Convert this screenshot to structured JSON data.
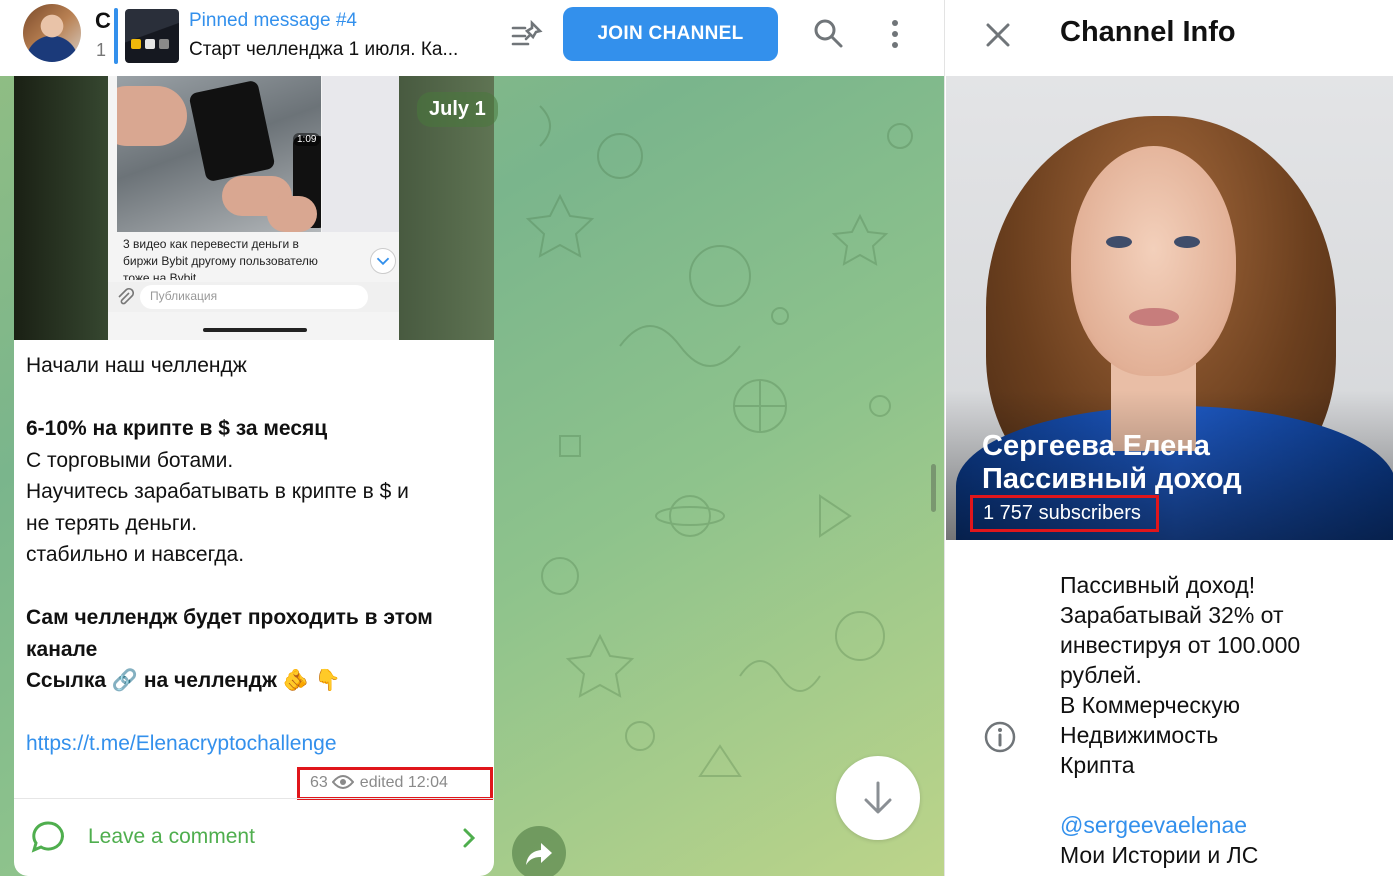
{
  "header": {
    "channel_initial": "С",
    "channel_sub": "1",
    "pinned_title": "Pinned message #4",
    "pinned_text": "Старт челленджа 1 июля. Ка...",
    "join_label": "JOIN CHANNEL"
  },
  "message": {
    "date": "July 1",
    "media": {
      "video_time": "1:09",
      "caption": "3 видео как перевести деньги в биржи Bybit другому пользователю тоже на Bybit",
      "input_placeholder": "Публикация"
    },
    "lines": [
      {
        "text": "Начали наш челлендж",
        "bold": false
      },
      {
        "text": "",
        "bold": false
      },
      {
        "text": "6-10% на крипте в $ за месяц",
        "bold": true
      },
      {
        "text": "С торговыми ботами.",
        "bold": false
      },
      {
        "text": "Научитесь зарабатывать в крипте в $ и",
        "bold": false
      },
      {
        "text": "не терять деньги.",
        "bold": false
      },
      {
        "text": "стабильно и навсегда.",
        "bold": false
      },
      {
        "text": "",
        "bold": false
      },
      {
        "text": "Сам челлендж будет проходить в этом",
        "bold": true
      },
      {
        "text": "канале",
        "bold": true
      },
      {
        "text": "Ссылка 🔗 на челлендж 🫵 👇",
        "bold": true
      },
      {
        "text": "",
        "bold": false
      }
    ],
    "link": "https://t.me/Elenacryptochallenge",
    "views": "63",
    "edited": "edited 12:04",
    "comment_label": "Leave a comment"
  },
  "info": {
    "title": "Channel Info",
    "channel_name": "Сергеева Елена Пассивный доход",
    "subscribers": "1 757 subscribers",
    "about_lines": [
      "Пассивный доход!",
      "Зарабатывай 32% от",
      "инвестируя от 100.000",
      "рублей.",
      "В Коммерческую",
      "Недвижимость",
      "Крипта",
      ""
    ],
    "username": "@sergeevaelenae",
    "after_username": "Мои Истории и ЛС"
  },
  "colors": {
    "accent": "#3390ec",
    "comment_green": "#4fae4e",
    "highlight_red": "#e0161b",
    "chat_bg": "#8fbd84"
  }
}
